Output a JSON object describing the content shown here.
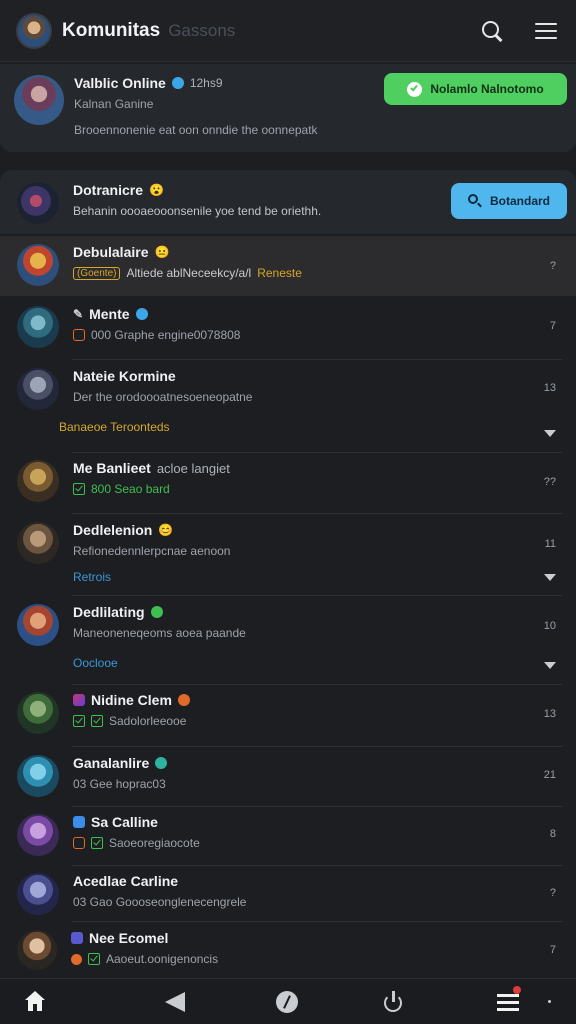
{
  "header": {
    "title": "Komunitas",
    "subtitle": "Gassons"
  },
  "featured": {
    "name": "Valblic Online",
    "name_tag": "12hs9",
    "status": "Kalnan Ganine",
    "description": "Brooennonenie eat oon onndie the oonnepatk",
    "action_label": "Nolamlo Nalnotomo"
  },
  "pinned": {
    "name": "Dotranicre",
    "description": "Behanin oooaeooonsenile yoe tend be oriethh.",
    "action_label": "Botandard"
  },
  "rows": [
    {
      "name": "Debulalaire",
      "badge": "(Goente)",
      "sub": "Altiede ablNeceekcy/a/l",
      "sub_highlight": "Reneste",
      "time": "?"
    },
    {
      "name": "Mente",
      "sub": "000 Graphe engine0078808",
      "time": "7"
    },
    {
      "name": "Nateie Kormine",
      "sub": "Der the orodoooatnesoeneopatne",
      "extra": "Banaeoe Teroonteds",
      "time": "13"
    },
    {
      "name": "Me Banlieet",
      "name_suffix": "acloe langiet",
      "sub": "800 Seao bard",
      "time": "??"
    },
    {
      "name": "Dedlelenion",
      "sub": "Refionedennlerpcnae aenoon",
      "extra": "Retrois",
      "time": "11"
    },
    {
      "name": "Dedlilating",
      "sub": "Maneoneneqeoms aoea paande",
      "extra": "Ooclooe",
      "time": "10"
    },
    {
      "name": "Nidine Clem",
      "sub": "Sadolorleeooe",
      "time": "13"
    },
    {
      "name": "Ganalanlire",
      "sub": "03 Gee hoprac03",
      "time": "21"
    },
    {
      "name": "Sa Calline",
      "sub": "Saoeoregiaocote",
      "time": "8"
    },
    {
      "name": "Acedlae Carline",
      "sub": "03 Gao Goooseonglenecengrele",
      "time": "?"
    },
    {
      "name": "Nee Ecomel",
      "sub": "Aaoeut.oonigenoncis",
      "time": "7"
    }
  ],
  "colors": {
    "green": "#4fcf5f",
    "blue": "#4fb6ee",
    "gold": "#d4a829",
    "link": "#3d96d6"
  }
}
